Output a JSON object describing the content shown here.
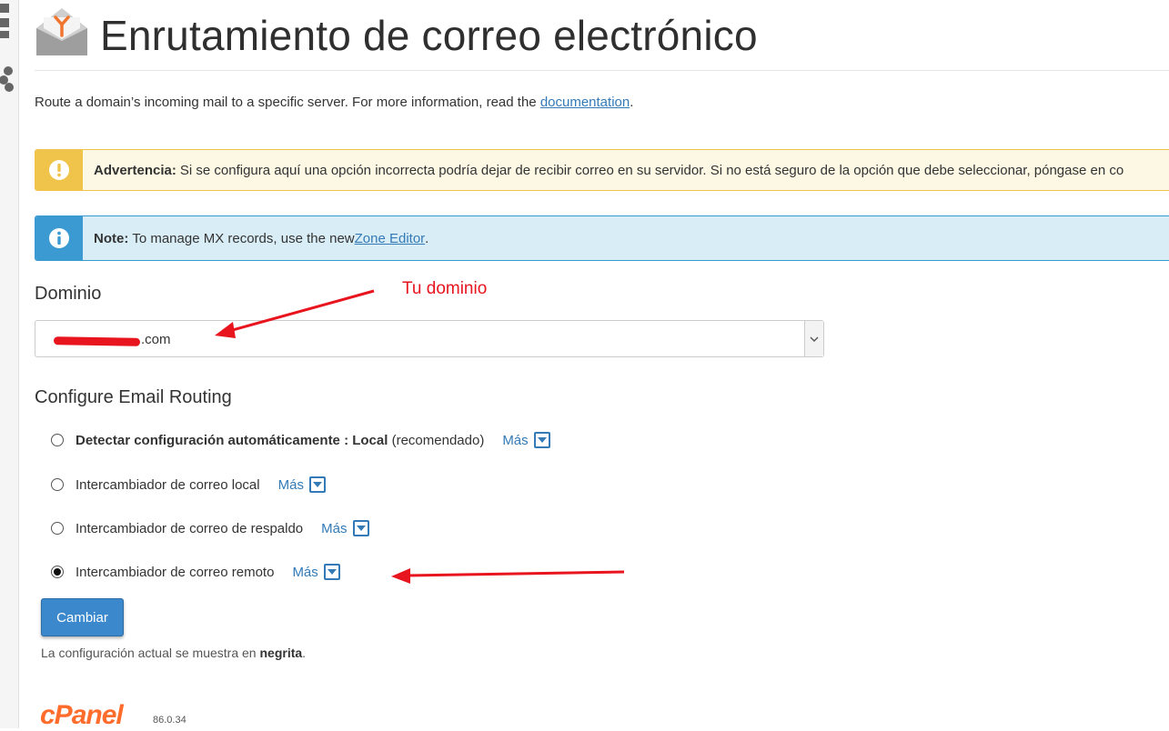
{
  "page": {
    "title": "Enrutamiento de correo electrónico",
    "description_prefix": "Route a domain’s incoming mail to a specific server. For more information, read the ",
    "description_link": "documentation",
    "description_suffix": "."
  },
  "alerts": {
    "warning": {
      "label": "Advertencia:",
      "text": "Si se configura aquí una opción incorrecta podría dejar de recibir correo en su servidor. Si no está seguro de la opción que debe seleccionar, póngase en co"
    },
    "note": {
      "label": "Note:",
      "text_prefix": "To manage MX records, use the new ",
      "link": "Zone Editor",
      "text_suffix": "."
    }
  },
  "domain_section": {
    "heading": "Dominio",
    "selected_value": ".com"
  },
  "routing_section": {
    "heading": "Configure Email Routing",
    "more_label": "Más",
    "options": [
      {
        "label_bold": "Detectar configuración automáticamente : Local",
        "label_extra": " (recomendado)",
        "checked": false
      },
      {
        "label": "Intercambiador de correo local",
        "checked": false
      },
      {
        "label": "Intercambiador de correo de respaldo",
        "checked": false
      },
      {
        "label": "Intercambiador de correo remoto",
        "checked": true
      }
    ],
    "submit_label": "Cambiar",
    "footer_prefix": "La configuración actual se muestra en ",
    "footer_bold": "negrita",
    "footer_suffix": "."
  },
  "annotation": {
    "text": "Tu dominio",
    "color": "#e8141e"
  },
  "footer": {
    "logo_text": "cPanel",
    "version": "86.0.34"
  },
  "colors": {
    "link": "#337ab7",
    "warning": "#f0c34a",
    "info": "#3c9ad3",
    "button": "#3b88cc",
    "logo": "#ff6c2c"
  }
}
